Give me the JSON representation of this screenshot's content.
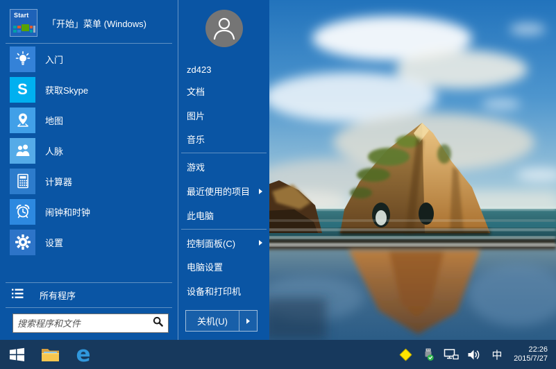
{
  "start_menu": {
    "header": {
      "title": "「开始」菜单 (Windows)",
      "tile_label": "Start"
    },
    "left_items": [
      {
        "label": "入门",
        "icon": "lightbulb-icon"
      },
      {
        "label": "获取Skype",
        "icon": "skype-icon",
        "tile_letter": "S"
      },
      {
        "label": "地图",
        "icon": "map-pin-icon"
      },
      {
        "label": "人脉",
        "icon": "people-icon"
      },
      {
        "label": "计算器",
        "icon": "calculator-icon"
      },
      {
        "label": "闹钟和时钟",
        "icon": "alarm-clock-icon"
      },
      {
        "label": "设置",
        "icon": "gear-icon"
      }
    ],
    "all_programs_label": "所有程序",
    "search_placeholder": "搜索程序和文件",
    "user_name": "zd423",
    "right_items": [
      {
        "label": "文档"
      },
      {
        "label": "图片"
      },
      {
        "label": "音乐"
      },
      {
        "label": "游戏"
      },
      {
        "label": "最近使用的项目",
        "has_submenu": true
      },
      {
        "label": "此电脑"
      },
      {
        "label": "控制面板(C)",
        "has_submenu": true
      },
      {
        "label": "电脑设置"
      },
      {
        "label": "设备和打印机"
      }
    ],
    "shutdown_label": "关机(U)"
  },
  "taskbar": {
    "edge_glyph": "e",
    "ime_indicator": "中",
    "clock": {
      "time": "22:26",
      "date": "2015/7/27"
    }
  },
  "colors": {
    "menu_background": "#0a55a4",
    "taskbar_background": "#17395d",
    "skype_tile": "#00b0f0",
    "tray_note_yellow": "#ffe500",
    "avatar_gray": "#757575"
  }
}
